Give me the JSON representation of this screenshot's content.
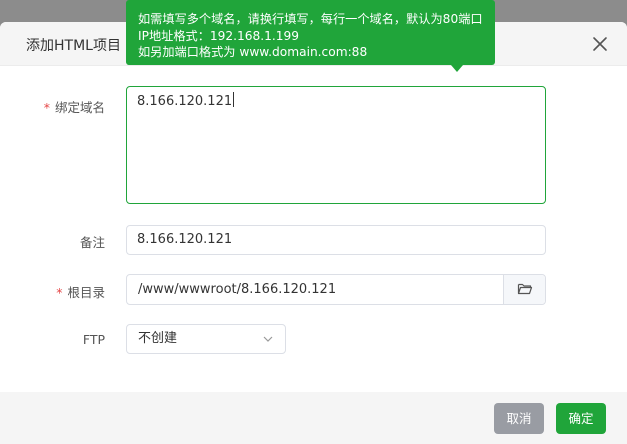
{
  "dialog": {
    "title": "添加HTML项目",
    "close_icon": "close-icon"
  },
  "tooltip": {
    "line1": "如需填写多个域名，请换行填写，每行一个域名，默认为80端口",
    "line2": "IP地址格式：192.168.1.199",
    "line3": "如另加端口格式为 www.domain.com:88"
  },
  "form": {
    "domain": {
      "label": "绑定域名",
      "required": true,
      "value": "8.166.120.121"
    },
    "remark": {
      "label": "备注",
      "value": "8.166.120.121"
    },
    "root": {
      "label": "根目录",
      "required": true,
      "value": "/www/wwwroot/8.166.120.121",
      "button_icon": "folder-icon"
    },
    "ftp": {
      "label": "FTP",
      "selected": "不创建",
      "arrow_icon": "chevron-down-icon"
    }
  },
  "footer": {
    "cancel_label": "取消",
    "ok_label": "确定"
  },
  "colors": {
    "accent": "#20a53a",
    "cancel": "#999ca3",
    "required": "#e54545"
  }
}
